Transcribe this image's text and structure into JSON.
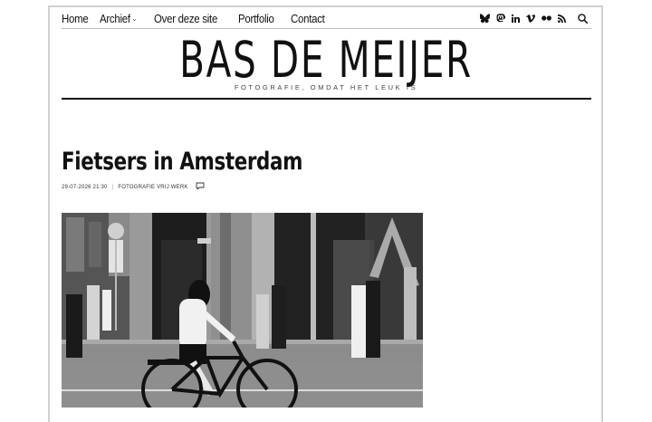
{
  "nav": {
    "items": [
      {
        "label": "Home"
      },
      {
        "label": "Archief"
      },
      {
        "label": "Over deze site"
      },
      {
        "label": "Portfolio"
      },
      {
        "label": "Contact"
      }
    ]
  },
  "social_icons": [
    "bluesky-icon",
    "mastodon-icon",
    "linkedin-icon",
    "vimeo-icon",
    "flickr-icon",
    "rss-icon"
  ],
  "site": {
    "title": "BAS DE MEIJER",
    "tagline": "FOTOGRAFIE, OMDAT HET LEUK IS"
  },
  "post": {
    "title": "Fietsers in Amsterdam",
    "date": "29-07-2026 21:30",
    "categories": "FOTOGRAFIE VRIJ WERK"
  },
  "colors": {
    "text": "#111111",
    "rule": "#111111",
    "background": "#ffffff"
  }
}
